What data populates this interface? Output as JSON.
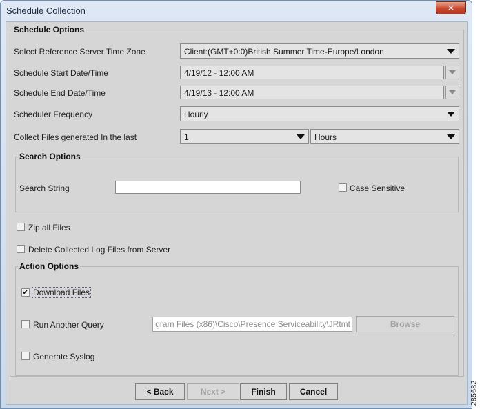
{
  "window": {
    "title": "Schedule Collection",
    "close_glyph": "✕"
  },
  "schedule_options": {
    "legend": "Schedule Options",
    "time_zone": {
      "label": "Select Reference Server Time Zone",
      "value": "Client:(GMT+0:0)British Summer Time-Europe/London"
    },
    "start": {
      "label": "Schedule Start Date/Time",
      "value": "4/19/12 - 12:00 AM"
    },
    "end": {
      "label": "Schedule End Date/Time",
      "value": "4/19/13 - 12:00 AM"
    },
    "frequency": {
      "label": "Scheduler Frequency",
      "value": "Hourly"
    },
    "collect_last": {
      "label": "Collect Files generated In the last",
      "count": "1",
      "unit": "Hours"
    }
  },
  "search_options": {
    "legend": "Search Options",
    "search_label": "Search String",
    "search_value": "",
    "case_sensitive_label": "Case Sensitive",
    "case_sensitive_checked": false
  },
  "zip_all": {
    "label": "Zip all Files",
    "checked": false
  },
  "delete_logs": {
    "label": "Delete Collected Log Files from Server",
    "checked": false
  },
  "action_options": {
    "legend": "Action Options",
    "download": {
      "label": "Download Files",
      "checked": true,
      "check_glyph": "✔"
    },
    "run_query": {
      "label": "Run Another Query",
      "checked": false,
      "path": "gram Files (x86)\\Cisco\\Presence Serviceability\\JRtmt",
      "browse_label": "Browse"
    },
    "syslog": {
      "label": "Generate Syslog",
      "checked": false
    }
  },
  "buttons": {
    "back": "< Back",
    "next": "Next >",
    "finish": "Finish",
    "cancel": "Cancel"
  },
  "figure_number": "285682"
}
